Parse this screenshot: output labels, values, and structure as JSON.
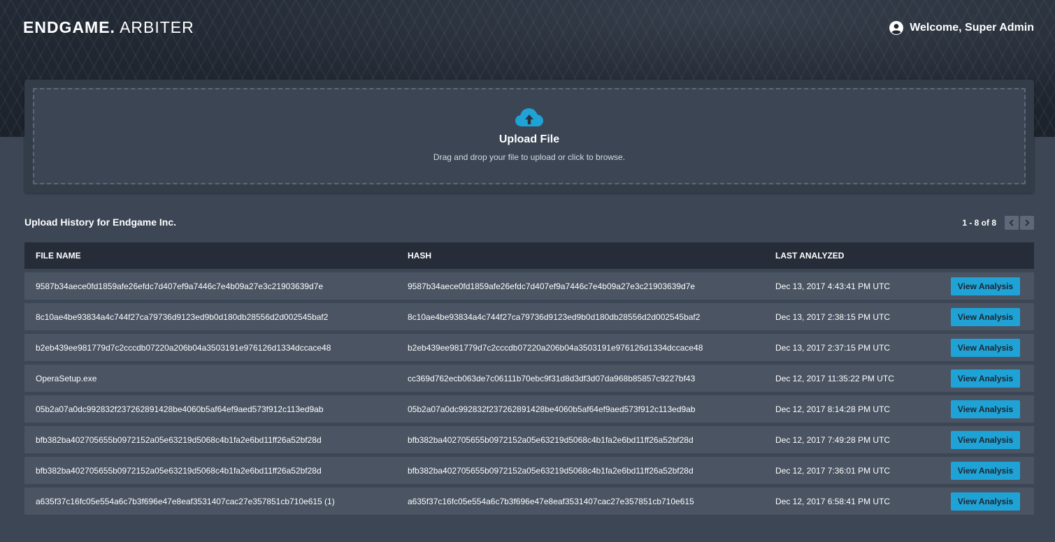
{
  "header": {
    "brand": "ENDGAME.",
    "product": "ARBITER",
    "welcome": "Welcome, Super Admin",
    "user_icon": "user-circle-icon"
  },
  "upload": {
    "icon": "cloud-upload-icon",
    "title": "Upload File",
    "subtitle": "Drag and drop your file to upload or click to browse.",
    "accent_color": "#1fa3d6"
  },
  "history": {
    "title": "Upload History for Endgame Inc.",
    "pager_text": "1 - 8 of 8",
    "prev_icon": "chevron-left-icon",
    "next_icon": "chevron-right-icon"
  },
  "table": {
    "columns": [
      "FILE NAME",
      "HASH",
      "LAST ANALYZED"
    ],
    "action_label": "View Analysis",
    "rows": [
      {
        "name": "9587b34aece0fd1859afe26efdc7d407ef9a7446c7e4b09a27e3c21903639d7e",
        "hash": "9587b34aece0fd1859afe26efdc7d407ef9a7446c7e4b09a27e3c21903639d7e",
        "date": "Dec 13, 2017 4:43:41 PM UTC"
      },
      {
        "name": "8c10ae4be93834a4c744f27ca79736d9123ed9b0d180db28556d2d002545baf2",
        "hash": "8c10ae4be93834a4c744f27ca79736d9123ed9b0d180db28556d2d002545baf2",
        "date": "Dec 13, 2017 2:38:15 PM UTC"
      },
      {
        "name": "b2eb439ee981779d7c2cccdb07220a206b04a3503191e976126d1334dccace48",
        "hash": "b2eb439ee981779d7c2cccdb07220a206b04a3503191e976126d1334dccace48",
        "date": "Dec 13, 2017 2:37:15 PM UTC"
      },
      {
        "name": "OperaSetup.exe",
        "hash": "cc369d762ecb063de7c06111b70ebc9f31d8d3df3d07da968b85857c9227bf43",
        "date": "Dec 12, 2017 11:35:22 PM UTC"
      },
      {
        "name": "05b2a07a0dc992832f237262891428be4060b5af64ef9aed573f912c113ed9ab",
        "hash": "05b2a07a0dc992832f237262891428be4060b5af64ef9aed573f912c113ed9ab",
        "date": "Dec 12, 2017 8:14:28 PM UTC"
      },
      {
        "name": "bfb382ba402705655b0972152a05e63219d5068c4b1fa2e6bd11ff26a52bf28d",
        "hash": "bfb382ba402705655b0972152a05e63219d5068c4b1fa2e6bd11ff26a52bf28d",
        "date": "Dec 12, 2017 7:49:28 PM UTC"
      },
      {
        "name": "bfb382ba402705655b0972152a05e63219d5068c4b1fa2e6bd11ff26a52bf28d",
        "hash": "bfb382ba402705655b0972152a05e63219d5068c4b1fa2e6bd11ff26a52bf28d",
        "date": "Dec 12, 2017 7:36:01 PM UTC"
      },
      {
        "name": "a635f37c16fc05e554a6c7b3f696e47e8eaf3531407cac27e357851cb710e615 (1)",
        "hash": "a635f37c16fc05e554a6c7b3f696e47e8eaf3531407cac27e357851cb710e615",
        "date": "Dec 12, 2017 6:58:41 PM UTC"
      }
    ]
  }
}
